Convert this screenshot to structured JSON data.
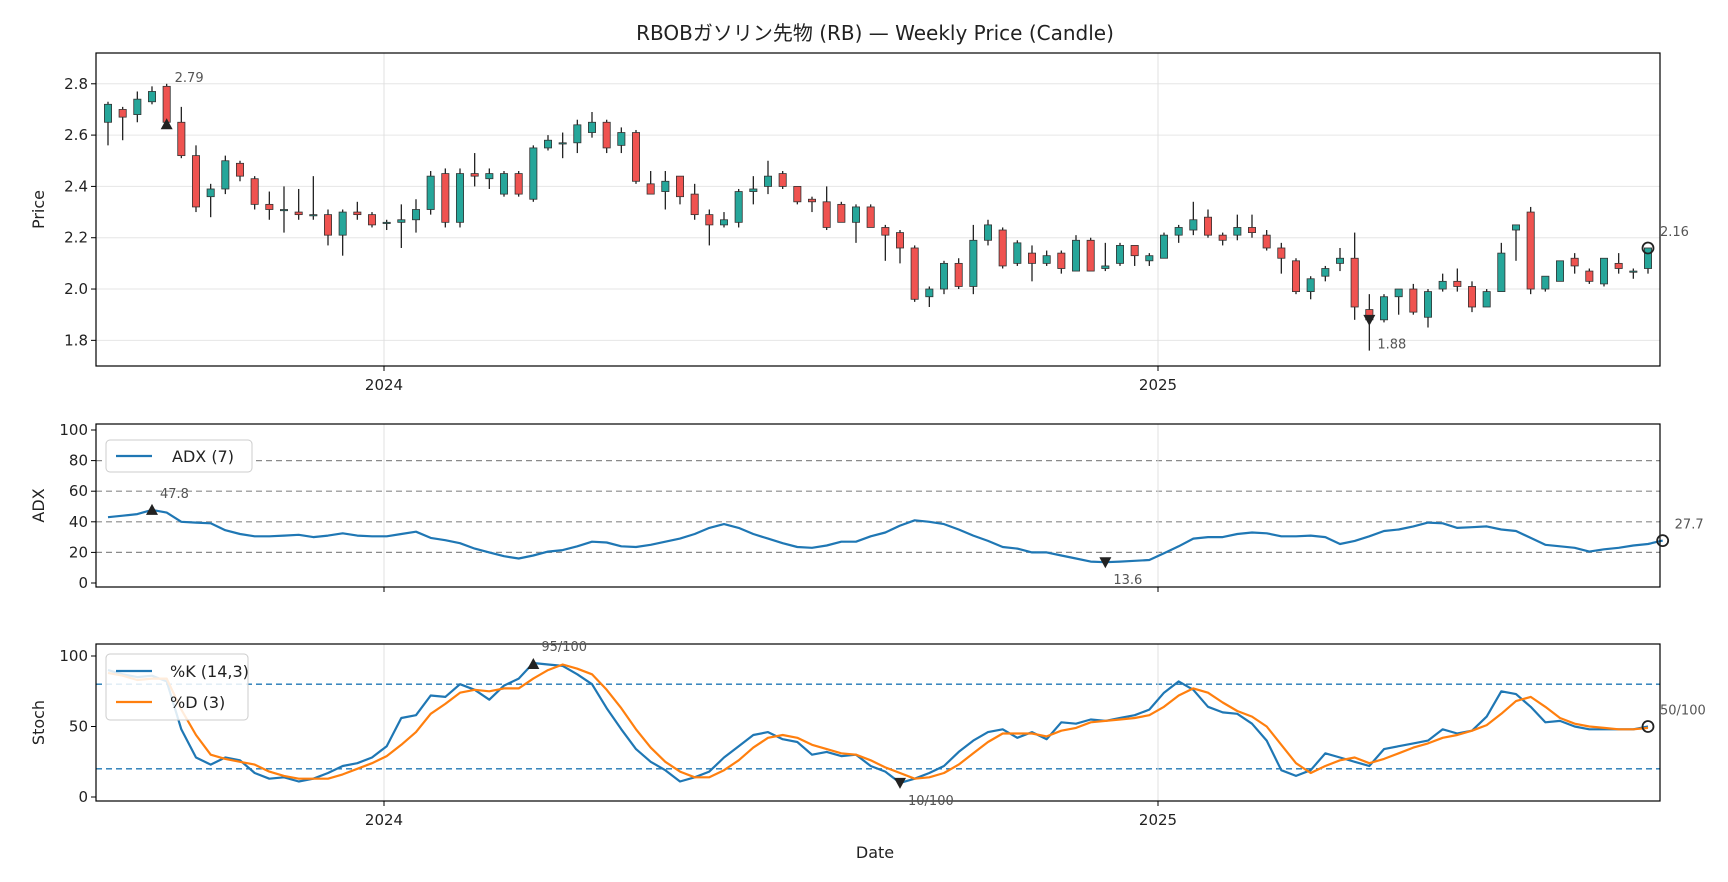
{
  "chart_data": {
    "type": "candlestick",
    "title": "RBOBガソリン先物 (RB) — Weekly Price (Candle)",
    "xlabel": "Date",
    "x_ticks": [
      "2024",
      "2025"
    ],
    "colors": {
      "up": "#26a69a",
      "down": "#ef5350",
      "adx": "#1f77b4",
      "k": "#1f77b4",
      "d": "#ff7f0e",
      "ref": "#1f77b4"
    },
    "price": {
      "ylabel": "Price",
      "ylim": [
        1.7,
        2.92
      ],
      "yticks": [
        "1.8",
        "2.0",
        "2.2",
        "2.4",
        "2.6",
        "2.8"
      ],
      "grid": true,
      "ohlc": [
        [
          2.65,
          2.73,
          2.56,
          2.72
        ],
        [
          2.7,
          2.71,
          2.58,
          2.67
        ],
        [
          2.68,
          2.77,
          2.65,
          2.74
        ],
        [
          2.73,
          2.79,
          2.72,
          2.77
        ],
        [
          2.79,
          2.8,
          2.63,
          2.65
        ],
        [
          2.65,
          2.71,
          2.51,
          2.52
        ],
        [
          2.52,
          2.56,
          2.3,
          2.32
        ],
        [
          2.36,
          2.41,
          2.28,
          2.39
        ],
        [
          2.39,
          2.52,
          2.37,
          2.5
        ],
        [
          2.49,
          2.5,
          2.42,
          2.44
        ],
        [
          2.43,
          2.44,
          2.31,
          2.33
        ],
        [
          2.33,
          2.38,
          2.27,
          2.31
        ],
        [
          2.31,
          2.4,
          2.22,
          2.31
        ],
        [
          2.3,
          2.39,
          2.27,
          2.29
        ],
        [
          2.29,
          2.44,
          2.27,
          2.29
        ],
        [
          2.29,
          2.31,
          2.17,
          2.21
        ],
        [
          2.21,
          2.31,
          2.13,
          2.3
        ],
        [
          2.3,
          2.34,
          2.27,
          2.29
        ],
        [
          2.29,
          2.3,
          2.24,
          2.25
        ],
        [
          2.26,
          2.27,
          2.23,
          2.26
        ],
        [
          2.26,
          2.33,
          2.16,
          2.27
        ],
        [
          2.27,
          2.35,
          2.22,
          2.31
        ],
        [
          2.31,
          2.46,
          2.29,
          2.44
        ],
        [
          2.45,
          2.47,
          2.24,
          2.26
        ],
        [
          2.26,
          2.47,
          2.24,
          2.45
        ],
        [
          2.45,
          2.53,
          2.4,
          2.44
        ],
        [
          2.43,
          2.47,
          2.39,
          2.45
        ],
        [
          2.37,
          2.46,
          2.36,
          2.45
        ],
        [
          2.45,
          2.46,
          2.36,
          2.37
        ],
        [
          2.35,
          2.56,
          2.34,
          2.55
        ],
        [
          2.55,
          2.6,
          2.54,
          2.58
        ],
        [
          2.57,
          2.61,
          2.51,
          2.57
        ],
        [
          2.57,
          2.66,
          2.53,
          2.64
        ],
        [
          2.61,
          2.69,
          2.59,
          2.65
        ],
        [
          2.65,
          2.66,
          2.53,
          2.55
        ],
        [
          2.56,
          2.63,
          2.53,
          2.61
        ],
        [
          2.61,
          2.62,
          2.41,
          2.42
        ],
        [
          2.41,
          2.46,
          2.37,
          2.37
        ],
        [
          2.38,
          2.46,
          2.31,
          2.42
        ],
        [
          2.44,
          2.44,
          2.33,
          2.36
        ],
        [
          2.37,
          2.41,
          2.27,
          2.29
        ],
        [
          2.29,
          2.31,
          2.17,
          2.25
        ],
        [
          2.25,
          2.3,
          2.24,
          2.27
        ],
        [
          2.26,
          2.39,
          2.24,
          2.38
        ],
        [
          2.38,
          2.44,
          2.33,
          2.39
        ],
        [
          2.4,
          2.5,
          2.37,
          2.44
        ],
        [
          2.45,
          2.46,
          2.39,
          2.4
        ],
        [
          2.4,
          2.4,
          2.33,
          2.34
        ],
        [
          2.35,
          2.36,
          2.3,
          2.34
        ],
        [
          2.34,
          2.4,
          2.23,
          2.24
        ],
        [
          2.33,
          2.34,
          2.26,
          2.26
        ],
        [
          2.26,
          2.33,
          2.18,
          2.32
        ],
        [
          2.32,
          2.33,
          2.24,
          2.24
        ],
        [
          2.24,
          2.25,
          2.11,
          2.21
        ],
        [
          2.22,
          2.23,
          2.1,
          2.16
        ],
        [
          2.16,
          2.17,
          1.95,
          1.96
        ],
        [
          1.97,
          2.01,
          1.93,
          2.0
        ],
        [
          2.0,
          2.11,
          1.98,
          2.1
        ],
        [
          2.1,
          2.12,
          2.0,
          2.01
        ],
        [
          2.01,
          2.25,
          1.98,
          2.19
        ],
        [
          2.19,
          2.27,
          2.17,
          2.25
        ],
        [
          2.23,
          2.24,
          2.08,
          2.09
        ],
        [
          2.1,
          2.19,
          2.09,
          2.18
        ],
        [
          2.14,
          2.17,
          2.03,
          2.1
        ],
        [
          2.1,
          2.15,
          2.09,
          2.13
        ],
        [
          2.14,
          2.15,
          2.06,
          2.08
        ],
        [
          2.07,
          2.21,
          2.07,
          2.19
        ],
        [
          2.19,
          2.2,
          2.07,
          2.07
        ],
        [
          2.08,
          2.18,
          2.07,
          2.09
        ],
        [
          2.1,
          2.18,
          2.09,
          2.17
        ],
        [
          2.17,
          2.17,
          2.09,
          2.13
        ],
        [
          2.11,
          2.14,
          2.09,
          2.13
        ],
        [
          2.12,
          2.22,
          2.12,
          2.21
        ],
        [
          2.21,
          2.25,
          2.18,
          2.24
        ],
        [
          2.23,
          2.34,
          2.21,
          2.27
        ],
        [
          2.28,
          2.31,
          2.2,
          2.21
        ],
        [
          2.21,
          2.22,
          2.17,
          2.19
        ],
        [
          2.21,
          2.29,
          2.19,
          2.24
        ],
        [
          2.24,
          2.29,
          2.2,
          2.22
        ],
        [
          2.21,
          2.23,
          2.15,
          2.16
        ],
        [
          2.16,
          2.18,
          2.06,
          2.12
        ],
        [
          2.11,
          2.12,
          1.98,
          1.99
        ],
        [
          1.99,
          2.05,
          1.96,
          2.04
        ],
        [
          2.05,
          2.09,
          2.03,
          2.08
        ],
        [
          2.1,
          2.16,
          2.07,
          2.12
        ],
        [
          2.12,
          2.22,
          1.88,
          1.93
        ],
        [
          1.92,
          1.98,
          1.76,
          1.88
        ],
        [
          1.88,
          1.98,
          1.87,
          1.97
        ],
        [
          1.97,
          2.0,
          1.9,
          2.0
        ],
        [
          2.0,
          2.02,
          1.9,
          1.91
        ],
        [
          1.89,
          2.0,
          1.85,
          1.99
        ],
        [
          2.0,
          2.06,
          1.99,
          2.03
        ],
        [
          2.03,
          2.08,
          1.99,
          2.01
        ],
        [
          2.01,
          2.03,
          1.91,
          1.93
        ],
        [
          1.93,
          2.0,
          1.93,
          1.99
        ],
        [
          1.99,
          2.18,
          1.99,
          2.14
        ],
        [
          2.23,
          2.25,
          2.11,
          2.25
        ],
        [
          2.3,
          2.32,
          1.98,
          2.0
        ],
        [
          2.0,
          2.05,
          1.99,
          2.05
        ],
        [
          2.03,
          2.11,
          2.03,
          2.11
        ],
        [
          2.12,
          2.14,
          2.06,
          2.09
        ],
        [
          2.07,
          2.08,
          2.02,
          2.03
        ],
        [
          2.02,
          2.08,
          2.01,
          2.12
        ],
        [
          2.1,
          2.14,
          2.06,
          2.08
        ],
        [
          2.07,
          2.08,
          2.04,
          2.07
        ],
        [
          2.08,
          2.16,
          2.06,
          2.16
        ]
      ]
    },
    "adx": {
      "ylabel": "ADX",
      "ylim": [
        0,
        100
      ],
      "yticks": [
        "0",
        "20",
        "40",
        "60",
        "80",
        "100"
      ],
      "ref_lines": [
        20,
        40,
        60,
        80
      ],
      "series": [
        {
          "name": "ADX (7)",
          "values": [
            43,
            44,
            45,
            47.8,
            46,
            40,
            39.5,
            39,
            34.5,
            32,
            30.5,
            30.5,
            31,
            31.5,
            30,
            31,
            32.5,
            31,
            30.5,
            30.5,
            32,
            33.5,
            29.5,
            28,
            26,
            22.5,
            20,
            17.5,
            16,
            18,
            20.5,
            21.5,
            24,
            27,
            26.5,
            24,
            23.5,
            25,
            27,
            29,
            32,
            36,
            38.5,
            36,
            32,
            29,
            26,
            23.5,
            23,
            24.5,
            27,
            27,
            30.5,
            33,
            37.5,
            41,
            40,
            38.5,
            35,
            31,
            27.5,
            23.5,
            22.5,
            20,
            20,
            18,
            16,
            14,
            13.6,
            14,
            14.5,
            15,
            19.5,
            24,
            29,
            30,
            30,
            32,
            33,
            32.5,
            30.5,
            30.5,
            31,
            30,
            25.5,
            27.5,
            30.5,
            34,
            35,
            37,
            39.5,
            39,
            36,
            36.5,
            37,
            35,
            34,
            29.5,
            25,
            24,
            23,
            20.5,
            22,
            23,
            24.5,
            25.5,
            27.7
          ]
        }
      ]
    },
    "stoch": {
      "ylabel": "Stoch",
      "ylim": [
        0,
        100
      ],
      "yticks": [
        "0",
        "50",
        "100"
      ],
      "ref_lines": [
        20,
        80
      ],
      "series": [
        {
          "name": "%K (14,3)",
          "values": [
            90,
            87,
            85,
            86,
            82,
            48,
            28,
            23,
            28,
            26,
            17,
            13,
            14,
            11,
            13,
            17,
            22,
            24,
            28,
            36,
            56,
            58,
            72,
            71,
            80,
            76,
            69,
            79,
            84,
            95,
            94,
            93,
            87,
            80,
            63,
            48,
            34,
            25,
            19,
            11,
            14,
            18,
            28,
            36,
            44,
            46,
            41,
            39,
            30,
            32,
            29,
            30,
            22,
            18,
            10,
            13,
            17,
            22,
            32,
            40,
            46,
            48,
            42,
            46,
            41,
            53,
            52,
            55,
            54,
            56,
            58,
            62,
            74,
            82,
            76,
            64,
            60,
            59,
            52,
            40,
            19,
            15,
            19,
            31,
            28,
            25,
            22,
            34,
            36,
            38,
            40,
            48,
            45,
            47,
            57,
            75,
            73,
            64,
            53,
            54,
            50,
            48,
            48,
            48,
            48,
            50
          ]
        },
        {
          "name": "%D (3)",
          "values": [
            88,
            86,
            83,
            84,
            84,
            62,
            44,
            30,
            27,
            25,
            23,
            18,
            15,
            13,
            13,
            13,
            16,
            20,
            24,
            29,
            37,
            46,
            59,
            66,
            74,
            76,
            75,
            77,
            77,
            84,
            90,
            94,
            91,
            87,
            76,
            63,
            48,
            35,
            25,
            18,
            14,
            14,
            19,
            26,
            35,
            42,
            44,
            42,
            37,
            34,
            31,
            30,
            26,
            21,
            17,
            13,
            14,
            17,
            23,
            31,
            39,
            45,
            45,
            45,
            43,
            47,
            49,
            53,
            54,
            55,
            56,
            58,
            64,
            72,
            77,
            74,
            67,
            61,
            57,
            50,
            37,
            24,
            17,
            22,
            26,
            28,
            24,
            27,
            31,
            35,
            38,
            42,
            44,
            47,
            51,
            59,
            68,
            71,
            64,
            56,
            52,
            50,
            49,
            48,
            48,
            49
          ]
        }
      ]
    },
    "annotations": {
      "price_max": "2.79",
      "price_min": "1.88",
      "price_last": "2.16",
      "adx_max": "47.8",
      "adx_min": "13.6",
      "adx_last": "27.7",
      "stoch_max": "95/100",
      "stoch_min": "10/100",
      "stoch_last": "50/100"
    }
  }
}
